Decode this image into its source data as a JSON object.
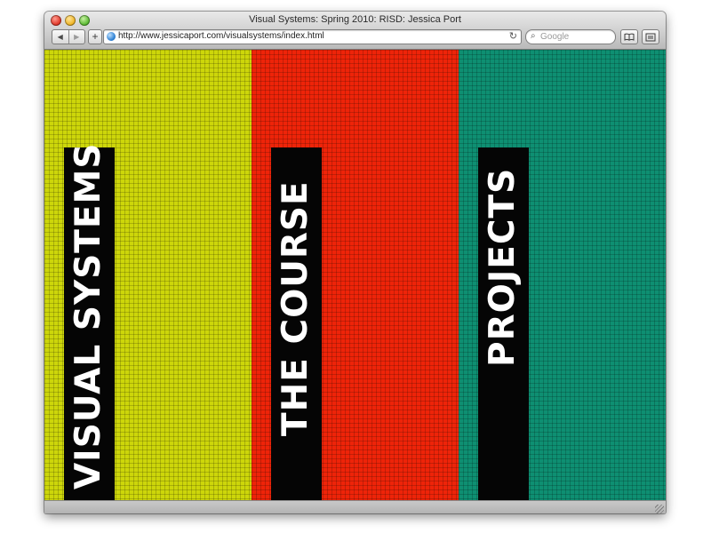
{
  "window": {
    "title": "Visual Systems: Spring 2010: RISD: Jessica Port"
  },
  "toolbar": {
    "back_icon": "◀",
    "forward_icon": "▶",
    "add_icon": "+",
    "reload_icon": "↻",
    "url": "http://www.jessicaport.com/visualsystems/index.html",
    "search_placeholder": "Google",
    "search_icon": "⌕"
  },
  "nav": [
    {
      "label": "VISUAL SYSTEMS",
      "color": "#cdd60a"
    },
    {
      "label": "THE COURSE",
      "color": "#ee2409"
    },
    {
      "label": "PROJECTS",
      "color": "#0e8f72"
    }
  ]
}
